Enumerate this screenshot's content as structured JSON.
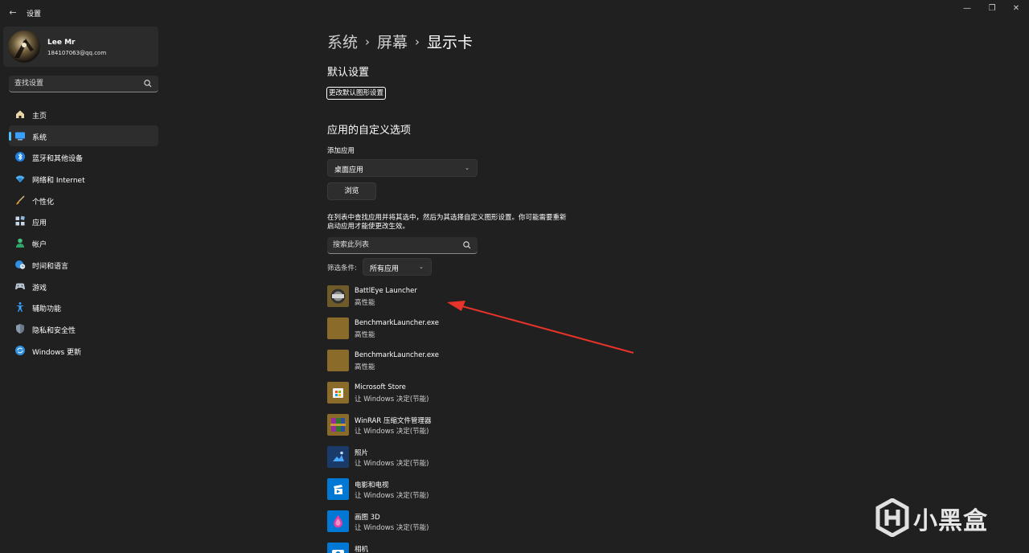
{
  "window": {
    "title": "设置"
  },
  "profile": {
    "name": "Lee Mr",
    "email": "184107063@qq.com"
  },
  "sidebar": {
    "search_placeholder": "查找设置",
    "items": [
      {
        "label": "主页",
        "icon": "home-icon",
        "active": false
      },
      {
        "label": "系统",
        "icon": "system-icon",
        "active": true
      },
      {
        "label": "蓝牙和其他设备",
        "icon": "bluetooth-icon",
        "active": false
      },
      {
        "label": "网络和 Internet",
        "icon": "wifi-icon",
        "active": false
      },
      {
        "label": "个性化",
        "icon": "brush-icon",
        "active": false
      },
      {
        "label": "应用",
        "icon": "apps-icon",
        "active": false
      },
      {
        "label": "帐户",
        "icon": "person-icon",
        "active": false
      },
      {
        "label": "时间和语言",
        "icon": "globe-clock-icon",
        "active": false
      },
      {
        "label": "游戏",
        "icon": "gamepad-icon",
        "active": false
      },
      {
        "label": "辅助功能",
        "icon": "accessibility-icon",
        "active": false
      },
      {
        "label": "隐私和安全性",
        "icon": "shield-icon",
        "active": false
      },
      {
        "label": "Windows 更新",
        "icon": "update-icon",
        "active": false
      }
    ]
  },
  "breadcrumb": {
    "items": [
      "系统",
      "屏幕",
      "显示卡"
    ],
    "separator": "›"
  },
  "defaults": {
    "title": "默认设置",
    "change_link": "更改默认图形设置"
  },
  "custom": {
    "title": "应用的自定义选项",
    "add_app_label": "添加应用",
    "app_type_value": "桌面应用",
    "browse_label": "浏览",
    "description": "在列表中查找应用并将其选中，然后为其选择自定义图形设置。你可能需要重新启动应用才能使更改生效。",
    "list_search_placeholder": "搜索此列表",
    "filter_label": "筛选条件:",
    "filter_value": "所有应用"
  },
  "apps": [
    {
      "name": "BattlEye Launcher",
      "pref": "高性能",
      "icon": "battleye-icon"
    },
    {
      "name": "BenchmarkLauncher.exe",
      "pref": "高性能",
      "icon": "generic-app-icon"
    },
    {
      "name": "BenchmarkLauncher.exe",
      "pref": "高性能",
      "icon": "generic-app-icon"
    },
    {
      "name": "Microsoft Store",
      "pref": "让 Windows 决定(节能)",
      "icon": "store-icon"
    },
    {
      "name": "WinRAR 压缩文件管理器",
      "pref": "让 Windows 决定(节能)",
      "icon": "winrar-icon"
    },
    {
      "name": "照片",
      "pref": "让 Windows 决定(节能)",
      "icon": "photos-icon"
    },
    {
      "name": "电影和电视",
      "pref": "让 Windows 决定(节能)",
      "icon": "movies-icon"
    },
    {
      "name": "画图 3D",
      "pref": "让 Windows 决定(节能)",
      "icon": "paint3d-icon"
    },
    {
      "name": "相机",
      "pref": "",
      "icon": "camera-icon"
    }
  ],
  "watermark": {
    "text": "小黑盒"
  },
  "colors": {
    "background": "#202020",
    "panel": "#2d2d2d",
    "accent": "#4cc2ff",
    "annotation_arrow": "#e8332a",
    "app_tile_gold": "#8a6b2a",
    "app_tile_blue": "#0078d4"
  }
}
